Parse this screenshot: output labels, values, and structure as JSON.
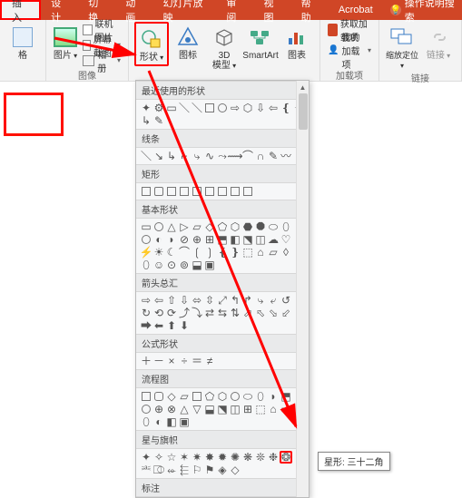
{
  "tabs": {
    "insert": "插入",
    "design": "设计",
    "transition": "切换",
    "animation": "动画",
    "slideshow": "幻灯片放映",
    "review": "审阅",
    "view": "视图",
    "help": "帮助",
    "acrobat": "Acrobat",
    "tell_me": "操作说明搜索"
  },
  "ribbon": {
    "table_label": "格",
    "image_group": "图像",
    "picture": "图片",
    "online_pic": "联机图片",
    "screenshot": "屏幕截图",
    "album": "相册",
    "shapes": "形状",
    "icons": "图标",
    "model3d": "3D\n模型",
    "smartart": "SmartArt",
    "chart": "图表",
    "addons_group": "加载项",
    "get_addons": "获取加载项",
    "my_addons": "我的加载项",
    "zoom": "缩放定位",
    "link": "链接",
    "links_group": "链接"
  },
  "dropdown": {
    "sections": {
      "recent": "最近使用的形状",
      "lines": "线条",
      "rectangles": "矩形",
      "basic": "基本形状",
      "arrows": "箭头总汇",
      "equations": "公式形状",
      "flowchart": "流程图",
      "stars": "星与旗帜",
      "callouts": "标注"
    }
  },
  "tooltip": "星形: 三十二角"
}
